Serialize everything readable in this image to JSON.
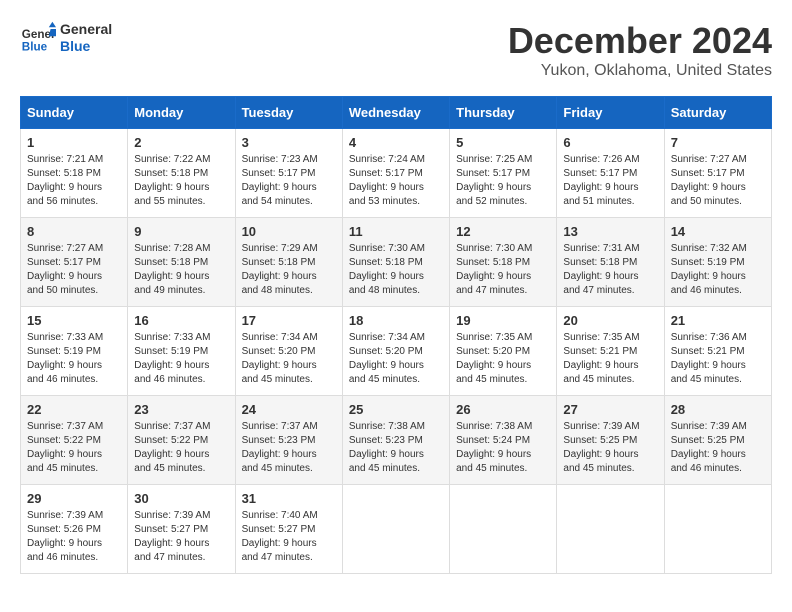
{
  "logo": {
    "line1": "General",
    "line2": "Blue"
  },
  "title": "December 2024",
  "subtitle": "Yukon, Oklahoma, United States",
  "days_header": [
    "Sunday",
    "Monday",
    "Tuesday",
    "Wednesday",
    "Thursday",
    "Friday",
    "Saturday"
  ],
  "weeks": [
    [
      {
        "day": "1",
        "sunrise": "7:21 AM",
        "sunset": "5:18 PM",
        "daylight": "9 hours and 56 minutes."
      },
      {
        "day": "2",
        "sunrise": "7:22 AM",
        "sunset": "5:18 PM",
        "daylight": "9 hours and 55 minutes."
      },
      {
        "day": "3",
        "sunrise": "7:23 AM",
        "sunset": "5:17 PM",
        "daylight": "9 hours and 54 minutes."
      },
      {
        "day": "4",
        "sunrise": "7:24 AM",
        "sunset": "5:17 PM",
        "daylight": "9 hours and 53 minutes."
      },
      {
        "day": "5",
        "sunrise": "7:25 AM",
        "sunset": "5:17 PM",
        "daylight": "9 hours and 52 minutes."
      },
      {
        "day": "6",
        "sunrise": "7:26 AM",
        "sunset": "5:17 PM",
        "daylight": "9 hours and 51 minutes."
      },
      {
        "day": "7",
        "sunrise": "7:27 AM",
        "sunset": "5:17 PM",
        "daylight": "9 hours and 50 minutes."
      }
    ],
    [
      {
        "day": "8",
        "sunrise": "7:27 AM",
        "sunset": "5:17 PM",
        "daylight": "9 hours and 50 minutes."
      },
      {
        "day": "9",
        "sunrise": "7:28 AM",
        "sunset": "5:18 PM",
        "daylight": "9 hours and 49 minutes."
      },
      {
        "day": "10",
        "sunrise": "7:29 AM",
        "sunset": "5:18 PM",
        "daylight": "9 hours and 48 minutes."
      },
      {
        "day": "11",
        "sunrise": "7:30 AM",
        "sunset": "5:18 PM",
        "daylight": "9 hours and 48 minutes."
      },
      {
        "day": "12",
        "sunrise": "7:30 AM",
        "sunset": "5:18 PM",
        "daylight": "9 hours and 47 minutes."
      },
      {
        "day": "13",
        "sunrise": "7:31 AM",
        "sunset": "5:18 PM",
        "daylight": "9 hours and 47 minutes."
      },
      {
        "day": "14",
        "sunrise": "7:32 AM",
        "sunset": "5:19 PM",
        "daylight": "9 hours and 46 minutes."
      }
    ],
    [
      {
        "day": "15",
        "sunrise": "7:33 AM",
        "sunset": "5:19 PM",
        "daylight": "9 hours and 46 minutes."
      },
      {
        "day": "16",
        "sunrise": "7:33 AM",
        "sunset": "5:19 PM",
        "daylight": "9 hours and 46 minutes."
      },
      {
        "day": "17",
        "sunrise": "7:34 AM",
        "sunset": "5:20 PM",
        "daylight": "9 hours and 45 minutes."
      },
      {
        "day": "18",
        "sunrise": "7:34 AM",
        "sunset": "5:20 PM",
        "daylight": "9 hours and 45 minutes."
      },
      {
        "day": "19",
        "sunrise": "7:35 AM",
        "sunset": "5:20 PM",
        "daylight": "9 hours and 45 minutes."
      },
      {
        "day": "20",
        "sunrise": "7:35 AM",
        "sunset": "5:21 PM",
        "daylight": "9 hours and 45 minutes."
      },
      {
        "day": "21",
        "sunrise": "7:36 AM",
        "sunset": "5:21 PM",
        "daylight": "9 hours and 45 minutes."
      }
    ],
    [
      {
        "day": "22",
        "sunrise": "7:37 AM",
        "sunset": "5:22 PM",
        "daylight": "9 hours and 45 minutes."
      },
      {
        "day": "23",
        "sunrise": "7:37 AM",
        "sunset": "5:22 PM",
        "daylight": "9 hours and 45 minutes."
      },
      {
        "day": "24",
        "sunrise": "7:37 AM",
        "sunset": "5:23 PM",
        "daylight": "9 hours and 45 minutes."
      },
      {
        "day": "25",
        "sunrise": "7:38 AM",
        "sunset": "5:23 PM",
        "daylight": "9 hours and 45 minutes."
      },
      {
        "day": "26",
        "sunrise": "7:38 AM",
        "sunset": "5:24 PM",
        "daylight": "9 hours and 45 minutes."
      },
      {
        "day": "27",
        "sunrise": "7:39 AM",
        "sunset": "5:25 PM",
        "daylight": "9 hours and 45 minutes."
      },
      {
        "day": "28",
        "sunrise": "7:39 AM",
        "sunset": "5:25 PM",
        "daylight": "9 hours and 46 minutes."
      }
    ],
    [
      {
        "day": "29",
        "sunrise": "7:39 AM",
        "sunset": "5:26 PM",
        "daylight": "9 hours and 46 minutes."
      },
      {
        "day": "30",
        "sunrise": "7:39 AM",
        "sunset": "5:27 PM",
        "daylight": "9 hours and 47 minutes."
      },
      {
        "day": "31",
        "sunrise": "7:40 AM",
        "sunset": "5:27 PM",
        "daylight": "9 hours and 47 minutes."
      },
      null,
      null,
      null,
      null
    ]
  ],
  "labels": {
    "sunrise": "Sunrise:",
    "sunset": "Sunset:",
    "daylight": "Daylight:"
  }
}
